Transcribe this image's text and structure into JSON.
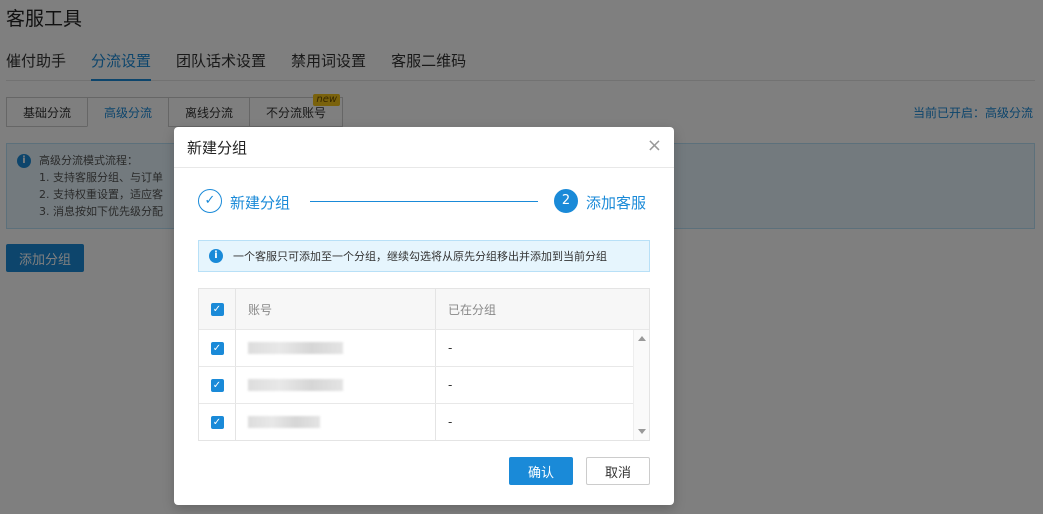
{
  "page": {
    "title": "客服工具",
    "main_tabs": [
      "催付助手",
      "分流设置",
      "团队话术设置",
      "禁用词设置",
      "客服二维码"
    ],
    "sub_tabs": [
      "基础分流",
      "高级分流",
      "离线分流",
      "不分流账号"
    ],
    "new_badge": "new",
    "current_open": "当前已开启：高级分流",
    "info_title": "高级分流模式流程：",
    "info_lines": [
      "1. 支持客服分组、与订单",
      "2. 支持权重设置，适应客",
      "3. 消息按如下优先级分配"
    ],
    "add_group_label": "添加分组"
  },
  "modal": {
    "title": "新建分组",
    "close_glyph": "×",
    "step1_label": "新建分组",
    "step1_glyph": "✓",
    "step2_number": "2",
    "step2_label": "添加客服",
    "notice": "一个客服只可添加至一个分组，继续勾选将从原先分组移出并添加到当前分组",
    "table": {
      "headers": [
        "账号",
        "已在分组"
      ],
      "rows": [
        {
          "group": "-"
        },
        {
          "group": "-"
        },
        {
          "group": "-"
        }
      ]
    },
    "confirm_label": "确认",
    "cancel_label": "取消"
  },
  "colors": {
    "accent": "#1a8ad8",
    "info_bg": "#e6f5fd",
    "badge": "#f5c518"
  },
  "icons": [
    "info-icon",
    "check-icon",
    "close-icon",
    "checkbox-checked-icon",
    "scroll-up-icon",
    "scroll-down-icon"
  ]
}
